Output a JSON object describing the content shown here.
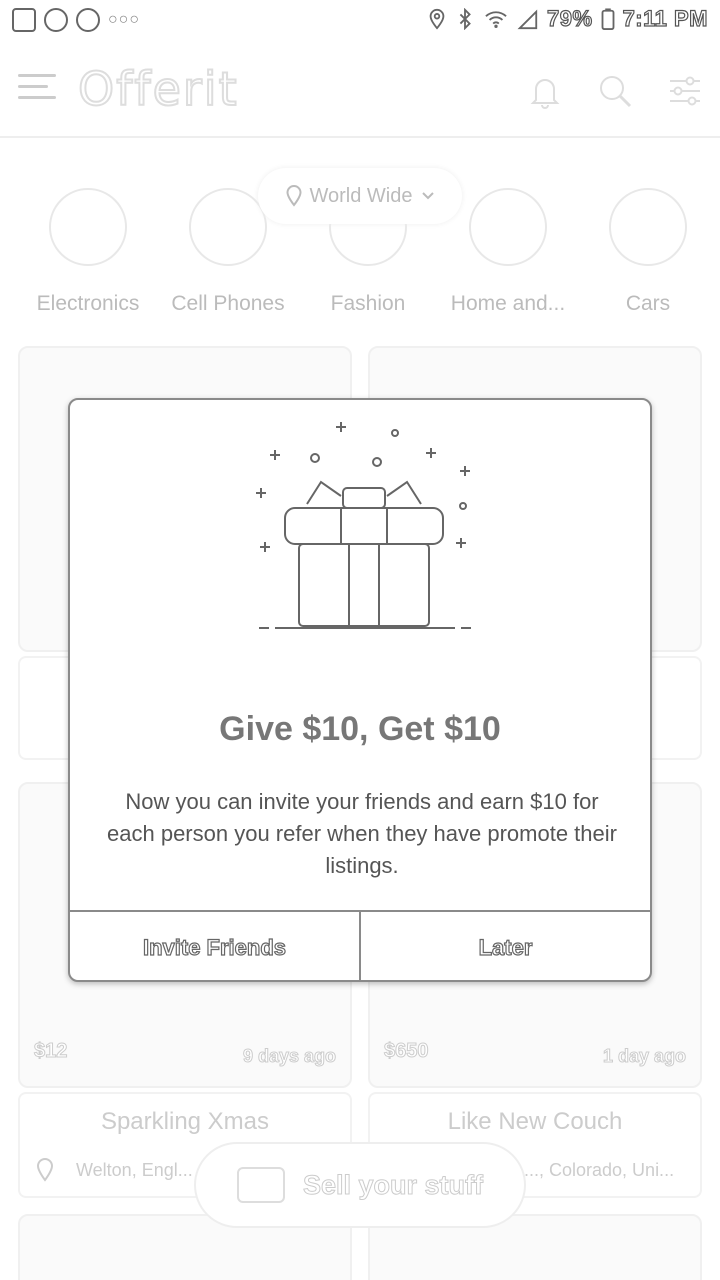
{
  "status_bar": {
    "battery": "79%",
    "time": "7:11 PM"
  },
  "app_bar": {
    "logo": "Offerit"
  },
  "location_selector": {
    "label": "World Wide"
  },
  "categories": [
    {
      "label": "Electronics"
    },
    {
      "label": "Cell Phones"
    },
    {
      "label": "Fashion"
    },
    {
      "label": "Home and..."
    },
    {
      "label": "Cars"
    }
  ],
  "listings": [
    {
      "price": "$12",
      "age": "9 days ago",
      "title": "Sparkling Xmas",
      "location": "Welton, Engl..."
    },
    {
      "price": "$650",
      "age": "1 day ago",
      "title": "Like New Couch",
      "location": "..., Colorado, Uni..."
    }
  ],
  "sell_button": {
    "label": "Sell your stuff"
  },
  "dialog": {
    "title": "Give $10, Get $10",
    "body": "Now you can invite your friends and earn $10 for each person you refer when they have promote their listings.",
    "primary_label": "Invite Friends",
    "secondary_label": "Later"
  }
}
